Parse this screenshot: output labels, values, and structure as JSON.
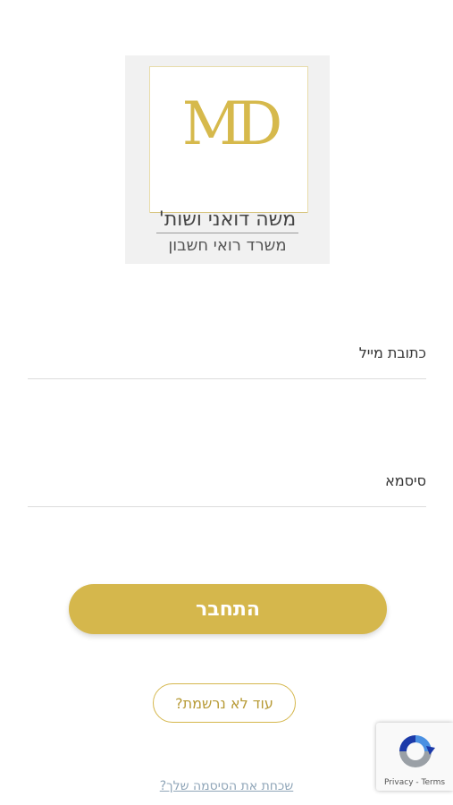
{
  "logo": {
    "monogram": "MD",
    "name": "משה דואני ושות'",
    "subtitle": "משרד רואי חשבון"
  },
  "form": {
    "email_label": "כתובת מייל",
    "password_label": "סיסמא",
    "login_button": "התחבר",
    "register_button": "עוד לא נרשמת?",
    "forgot_password_link": "שכחת את הסיסמה שלך?"
  },
  "recaptcha": {
    "privacy": "Privacy",
    "separator": " - ",
    "terms": "Terms",
    "icon": "recaptcha-icon"
  },
  "colors": {
    "accent": "#d5b74c",
    "link": "#8fa5b8"
  }
}
